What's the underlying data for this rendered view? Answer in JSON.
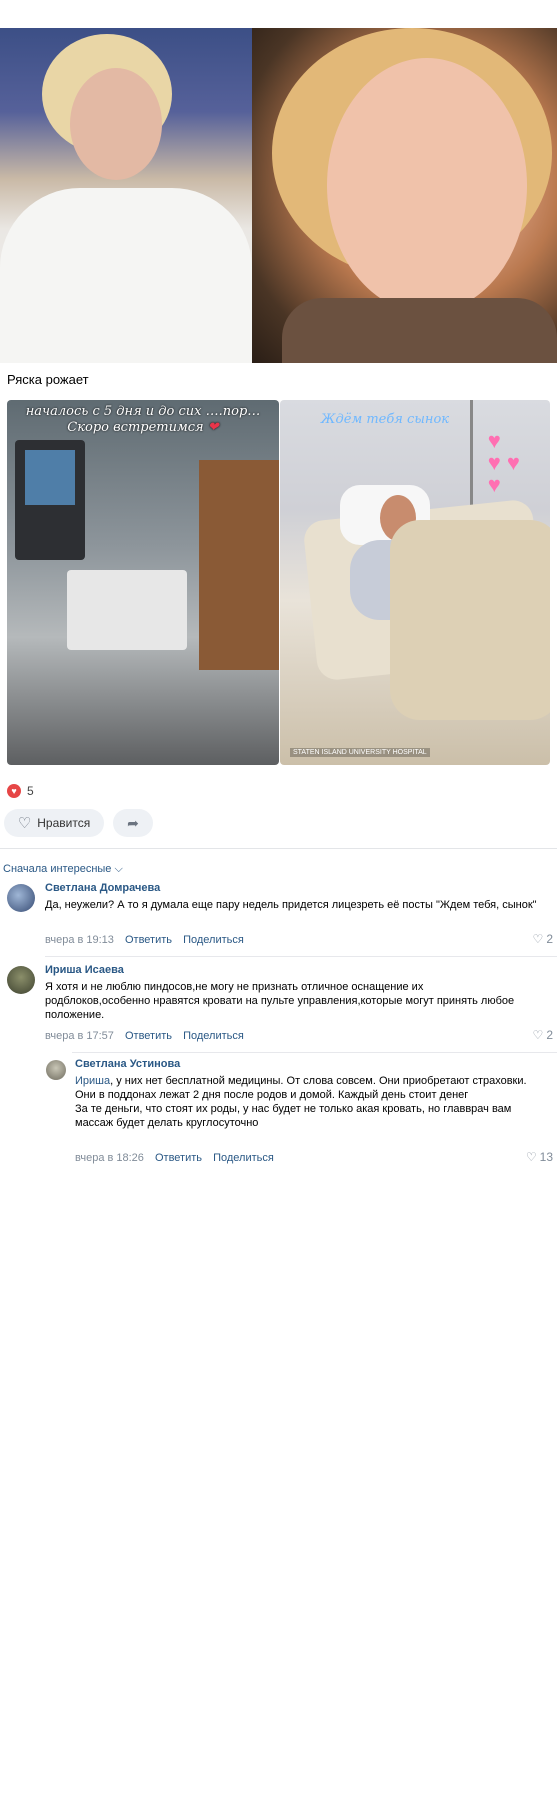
{
  "post": {
    "title": "Ряска рожает",
    "story_left_caption_line1": "началось с 5 дня и до сих ….пор…",
    "story_left_caption_line2": "Скоро встретимся",
    "story_right_caption": "Ждём тебя сынок",
    "hospital_tag": "STATEN ISLAND UNIVERSITY HOSPITAL",
    "likes_count": "5",
    "like_button_label": "Нравится",
    "sort_label": "Сначала интересные ⌵"
  },
  "comments": [
    {
      "author": "Светлана Домрачева",
      "text": "Да, неужели? А то я думала еще пару недель придется лицезреть её посты \"Ждем тебя, сынок\"",
      "time": "вчера в 19:13",
      "reply_label": "Ответить",
      "share_label": "Поделиться",
      "likes": "2"
    },
    {
      "author": "Ириша Исаева",
      "text": "Я хотя и не люблю пиндосов,не могу не признать отличное оснащение их родблоков,особенно нравятся кровати на пульте управления,которые могут принять любое положение.",
      "time": "вчера в 17:57",
      "reply_label": "Ответить",
      "share_label": "Поделиться",
      "likes": "2"
    },
    {
      "author": "Светлана Устинова",
      "reply_to": "Ириша",
      "text_line1": ", у них нет бесплатной медицины. От слова совсем. Они приобретают страховки. Они в поддонах лежат 2 дня после родов и домой. Каждый день стоит денег",
      "text_line2": "За те деньги, что стоят их роды, у нас будет не только акая кровать, но главврач вам массаж будет делать круглосуточно",
      "time": "вчера в 18:26",
      "reply_label": "Ответить",
      "share_label": "Поделиться",
      "likes": "13"
    }
  ]
}
